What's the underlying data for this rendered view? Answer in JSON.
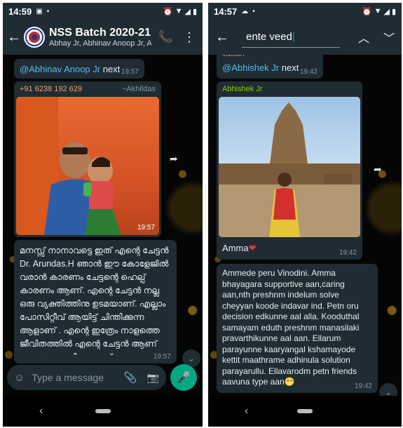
{
  "left": {
    "status": {
      "time": "14:59"
    },
    "header": {
      "title": "NSS Batch 2020-21",
      "subtitle": "Abhay Jr, Abhinav Anoop Jr, Abhi..."
    },
    "messages": {
      "next_mention": "@Abhinav Anoop Jr",
      "next_text": " next",
      "next_time": "19:57",
      "photo_sender": "+91 6238 192 629",
      "photo_sender_name": "~Akhildas",
      "photo_time": "19:57",
      "malayalam_text": "മനസ്സ് നാനാവട്ടെ ഇത് എന്റെ ചേട്ടൻ Dr. Arundas.H ഞാൻ ഈ കോളേജിൽ വരാൻ കാരണം ചേട്ടന്റെ ഹെല്പ് കാരണം ആണ്. എന്റെ ചേട്ടൻ നല്ല ഒരു വ്യക്തിത്തിനു ഉടമയാണ്. എല്ലാം പോസിറ്റീവ് ആയിട്ട് ചിന്തിക്കുന്ന ആളാണ് . എന്റെ ഇത്രേം നാളത്തെ ജീവിതത്തിൽ എന്റെ ചേട്ടൻ ആണ് ധൈര്യം തന്നിട്ടോള്ളത്.",
      "malayalam_time": "19:57"
    },
    "input": {
      "placeholder": "Type a message"
    }
  },
  "right": {
    "status": {
      "time": "14:57"
    },
    "search": {
      "query": "ente veed"
    },
    "messages": {
      "partial_sender": "valsan",
      "next_mention": "@Abhishek Jr",
      "next_text": " next",
      "next_time": "19:42",
      "photo_sender": "Abhishek Jr",
      "photo_caption": "Amma",
      "photo_caption_emoji": "❤",
      "photo_time": "19:42",
      "long_text": "Ammede peru Vinodini. Amma bhayagara supportive aan,caring aan,nth preshnm indelum solve cheyyan koode indavar ind. Petn oru decision edkunne aal alla. Kooduthal samayam eduth preshnm manasilaki pravarthikunne aal aan. Ellarum parayunne kaaryangal kshamayode kettit maathrame adhinula solution parayarullu. Ellavarodm petn friends aavuna type aan",
      "long_text_emoji": "😁",
      "long_time": "19:42",
      "bottom_emoji": "😀"
    }
  },
  "colors": {
    "bar": "#1f2c34",
    "bubble": "#1f2c34",
    "mention": "#53bdeb",
    "mic": "#00a884",
    "sender_green": "#8fce00"
  },
  "icons": [
    "back-arrow-icon",
    "group-avatar-icon",
    "add-call-icon",
    "more-vert-icon",
    "emoji-icon",
    "attach-icon",
    "camera-icon",
    "mic-icon",
    "chevron-up-icon",
    "chevron-down-icon",
    "forward-icon",
    "scroll-down-icon",
    "nav-back-icon",
    "nav-home-icon"
  ]
}
